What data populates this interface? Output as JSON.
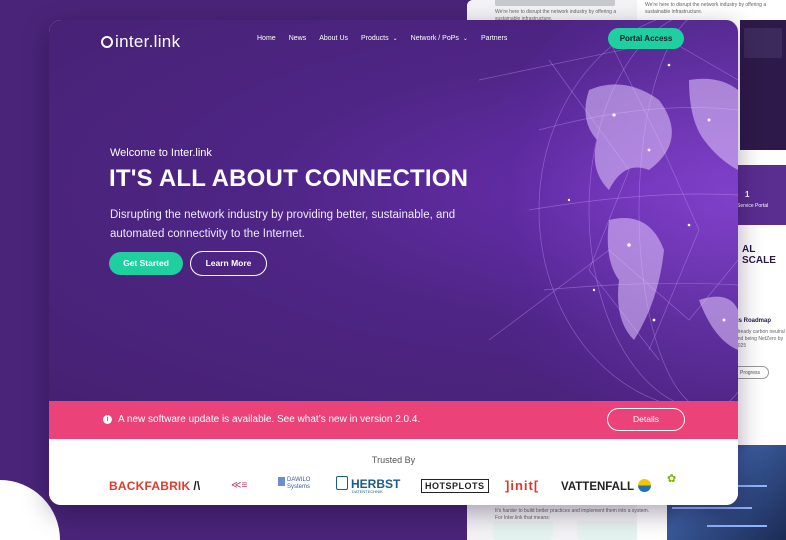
{
  "navbar": {
    "logo": "inter.link",
    "items": [
      {
        "label": "Home"
      },
      {
        "label": "News"
      },
      {
        "label": "About Us"
      },
      {
        "label": "Products"
      },
      {
        "label": "Network / PoPs"
      },
      {
        "label": "Partners"
      }
    ],
    "portal_label": "Portal Access"
  },
  "hero": {
    "welcome": "Welcome to Inter.link",
    "headline": "IT'S ALL ABOUT CONNECTION",
    "subtitle": "Disrupting the network industry by providing better, sustainable, and automated connectivity to the Internet.",
    "primary_button": "Get Started",
    "secondary_button": "Learn More"
  },
  "alert": {
    "icon": "info-icon",
    "message": "A new software update is available. See what’s new in version 2.0.4.",
    "button": "Details"
  },
  "trusted": {
    "title": "Trusted By",
    "logos": {
      "backfabrik": "BACKFABRIK",
      "dawilo_1": "DAWILO",
      "dawilo_2": "Systems",
      "herbst": "HERBST",
      "herbst_sub": "DATENTECHNIK",
      "hotsplots": "HOTSPLOTS",
      "init": "]init[",
      "vattenfall": "VATTENFALL"
    }
  },
  "background_page": {
    "intro": "We're here to disrupt the network industry by offering a sustainable infrastructure.",
    "scale_heading": "AL SCALE",
    "service_count": "1",
    "service_label": "Service Portal",
    "roadmap_heading": "us Roadmap",
    "roadmap_text": "already carbon neutral and being NetZero by 2025",
    "progress_label": "Progress",
    "practices_text": "It's harder to build better practices and implement them into a system. For Inter.link that means:"
  },
  "colors": {
    "brand_purple": "#4e2585",
    "accent_green": "#1fcf9f",
    "alert_pink": "#ea4279"
  }
}
